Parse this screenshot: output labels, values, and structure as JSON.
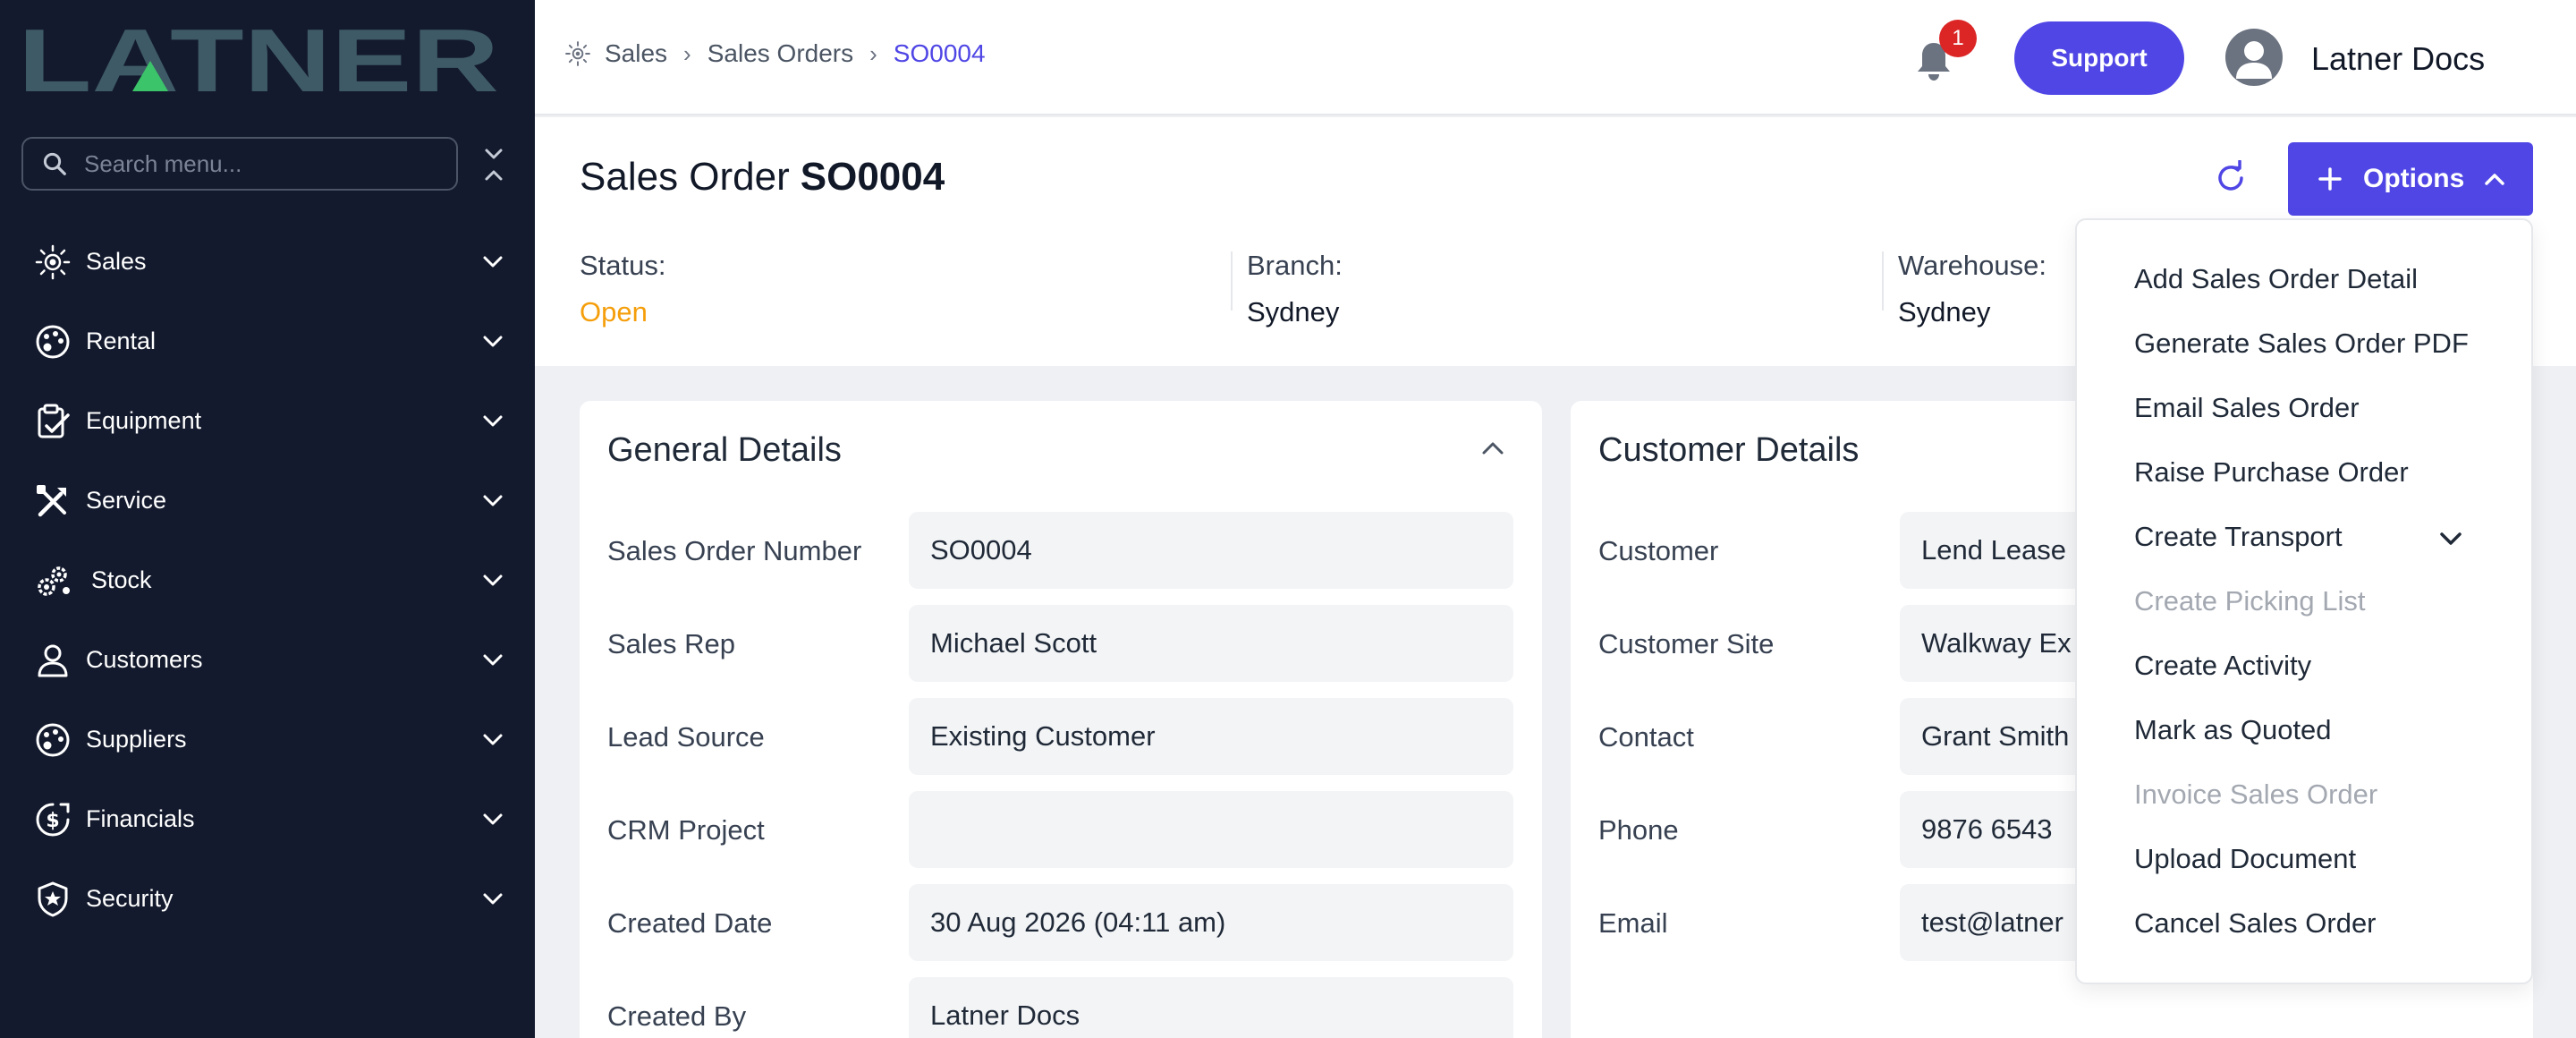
{
  "brand": {
    "logo_text": "LATNER"
  },
  "sidebar": {
    "search_placeholder": "Search menu...",
    "items": [
      {
        "label": "Sales",
        "icon": "sun-icon"
      },
      {
        "label": "Rental",
        "icon": "palette-icon"
      },
      {
        "label": "Equipment",
        "icon": "clipboard-check-icon"
      },
      {
        "label": "Service",
        "icon": "tools-icon"
      },
      {
        "label": "Stock",
        "icon": "gears-icon"
      },
      {
        "label": "Customers",
        "icon": "user-icon"
      },
      {
        "label": "Suppliers",
        "icon": "palette-icon"
      },
      {
        "label": "Financials",
        "icon": "dollar-icon"
      },
      {
        "label": "Security",
        "icon": "shield-icon"
      }
    ]
  },
  "header": {
    "breadcrumb": [
      "Sales",
      "Sales Orders",
      "SO0004"
    ],
    "notification_count": "1",
    "support_label": "Support",
    "user_name": "Latner Docs"
  },
  "page": {
    "title": "Sales Order",
    "order_number": "SO0004",
    "options_label": "Options",
    "status_label": "Status:",
    "status_value": "Open",
    "branch_label": "Branch:",
    "branch_value": "Sydney",
    "warehouse_label": "Warehouse:",
    "warehouse_value": "Sydney"
  },
  "general_details": {
    "title": "General Details",
    "rows": [
      {
        "label": "Sales Order Number",
        "value": "SO0004"
      },
      {
        "label": "Sales Rep",
        "value": "Michael Scott"
      },
      {
        "label": "Lead Source",
        "value": "Existing Customer"
      },
      {
        "label": "CRM Project",
        "value": ""
      },
      {
        "label": "Created Date",
        "value": "30 Aug 2026 (04:11 am)"
      },
      {
        "label": "Created By",
        "value": "Latner Docs"
      }
    ]
  },
  "customer_details": {
    "title": "Customer Details",
    "rows": [
      {
        "label": "Customer",
        "value": "Lend Lease"
      },
      {
        "label": "Customer Site",
        "value": "Walkway Ex"
      },
      {
        "label": "Contact",
        "value": "Grant Smith"
      },
      {
        "label": "Phone",
        "value": "9876 6543"
      },
      {
        "label": "Email",
        "value": "test@latner"
      }
    ]
  },
  "options_menu": {
    "items": [
      {
        "label": "Add Sales Order Detail",
        "disabled": false
      },
      {
        "label": "Generate Sales Order PDF",
        "disabled": false
      },
      {
        "label": "Email Sales Order",
        "disabled": false
      },
      {
        "label": "Raise Purchase Order",
        "disabled": false
      },
      {
        "label": "Create Transport",
        "disabled": false
      },
      {
        "label": "Create Picking List",
        "disabled": true
      },
      {
        "label": "Create Activity",
        "disabled": false
      },
      {
        "label": "Mark as Quoted",
        "disabled": false
      },
      {
        "label": "Invoice Sales Order",
        "disabled": true
      },
      {
        "label": "Upload Document",
        "disabled": false
      },
      {
        "label": "Cancel Sales Order",
        "disabled": false
      }
    ]
  },
  "colors": {
    "sidebar_bg": "#131a2d",
    "accent": "#4f46e5",
    "status_open": "#f59e0b",
    "badge": "#dc2626"
  }
}
